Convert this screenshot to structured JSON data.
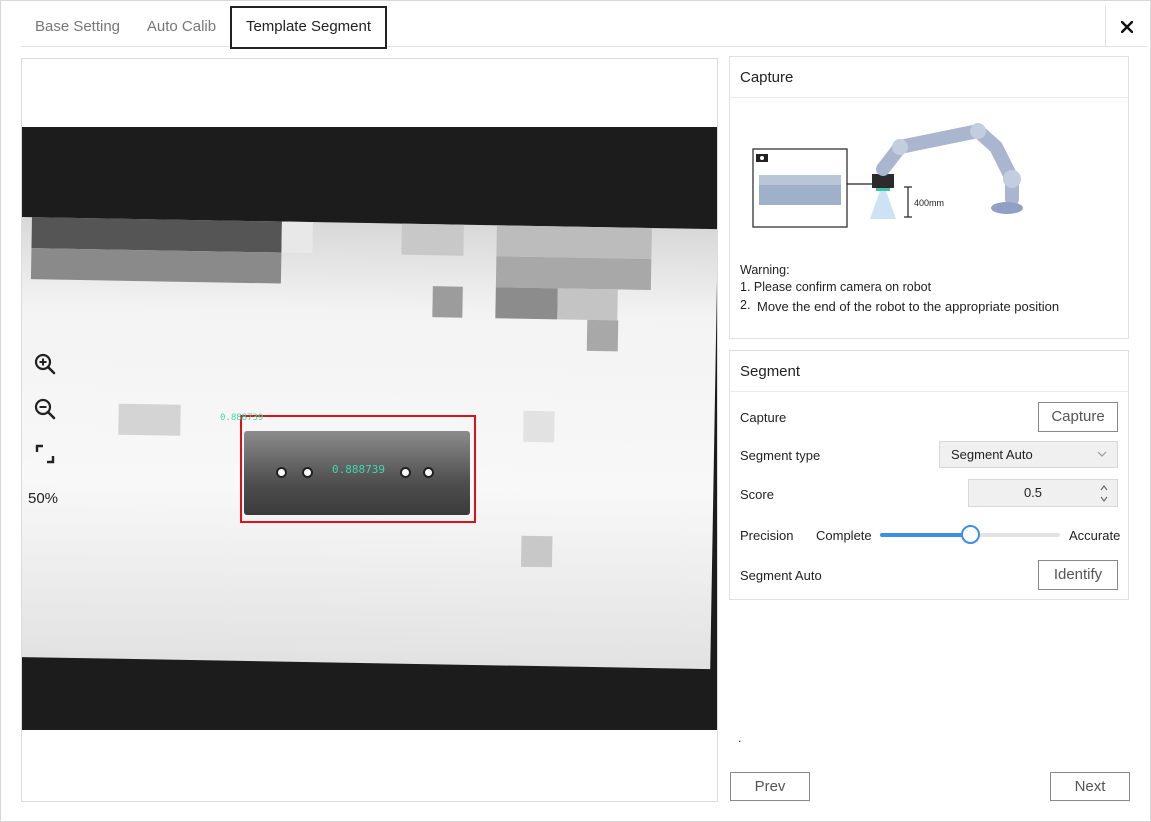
{
  "tabs": [
    {
      "label": "Base Setting"
    },
    {
      "label": "Auto Calib"
    },
    {
      "label": "Template Segment",
      "active": true
    }
  ],
  "close_icon": "close-icon",
  "viewer": {
    "zoom_level": "50%",
    "tools": [
      "zoom-in-icon",
      "zoom-out-icon",
      "fit-screen-icon"
    ],
    "overlay_score": "0.888739",
    "overlay_small": "0.888739",
    "box_color": "#e0101a"
  },
  "capture_panel": {
    "title": "Capture",
    "illustration_distance": "400mm",
    "warning_title": "Warning:",
    "warning_1": "1. Please confirm camera on robot",
    "warning_2_num": "2.",
    "warning_2": "Move the end of the robot to the appropriate position"
  },
  "segment_panel": {
    "title": "Segment",
    "capture_label": "Capture",
    "capture_button": "Capture",
    "segment_type_label": "Segment type",
    "segment_type_value": "Segment Auto",
    "score_label": "Score",
    "score_value": "0.5",
    "precision_label": "Precision",
    "precision_min": "Complete",
    "precision_max": "Accurate",
    "precision_value": 0.5,
    "segment_auto_label": "Segment Auto",
    "identify_button": "Identify",
    "accent": "#3d8ee6"
  },
  "footer": {
    "dot": ".",
    "prev": "Prev",
    "next": "Next"
  }
}
